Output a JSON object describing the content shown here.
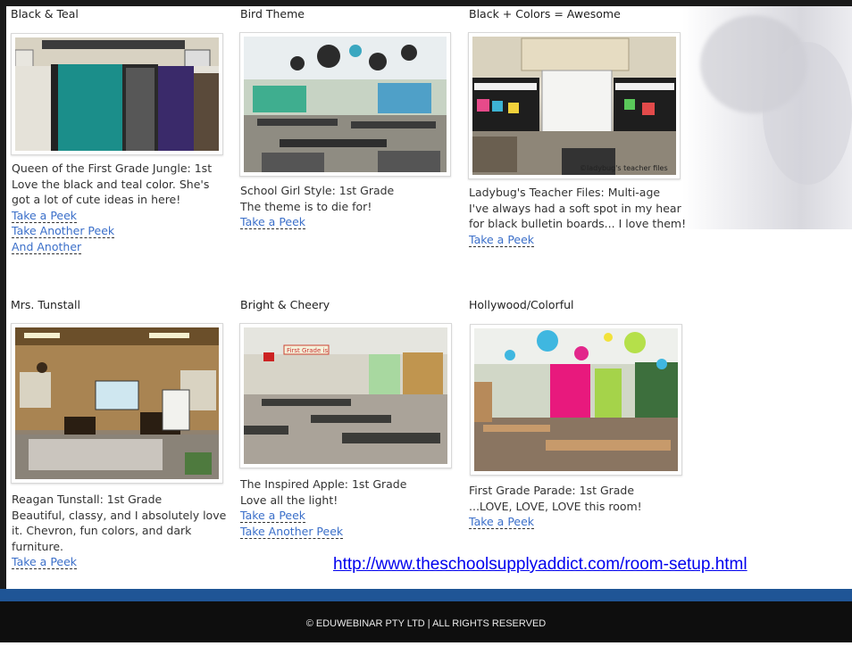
{
  "cards": [
    {
      "title": "Black & Teal",
      "lines": [
        "Queen of the First Grade Jungle: 1st",
        "Love the black and teal color.  She's",
        "got a lot of cute ideas in here!"
      ],
      "links": [
        "Take a Peek",
        "Take Another Peek",
        "And Another"
      ]
    },
    {
      "title": "Bird Theme",
      "lines": [
        "School Girl Style: 1st Grade",
        "The theme is to die for!"
      ],
      "links": [
        "Take a Peek"
      ]
    },
    {
      "title": "Black + Colors = Awesome",
      "lines": [
        "Ladybug's Teacher Files: Multi-age",
        "I've always had a soft spot in my hear",
        "for black bulletin boards... I love them!"
      ],
      "links": [
        "Take a Peek"
      ],
      "photo_caption": "©ladybug's teacher files"
    },
    {
      "title": "Mrs. Tunstall",
      "lines": [
        "Reagan Tunstall: 1st Grade",
        "Beautiful, classy, and I absolutely love",
        "it.  Chevron, fun colors, and dark",
        "furniture."
      ],
      "links": [
        "Take a Peek"
      ]
    },
    {
      "title": "Bright & Cheery",
      "lines": [
        "The Inspired Apple: 1st Grade",
        "Love all the light!"
      ],
      "links": [
        "Take a Peek",
        "Take Another Peek"
      ],
      "photo_caption": "First Grade is"
    },
    {
      "title": "Hollywood/Colorful",
      "lines": [
        "First Grade Parade: 1st Grade",
        "...LOVE, LOVE, LOVE this room!"
      ],
      "links": [
        "Take a Peek"
      ]
    }
  ],
  "source_url": "http://www.theschoolsupplyaddict.com/room-setup.html",
  "footer": "© EDUWEBINAR PTY LTD | ALL RIGHTS RESERVED",
  "colors": {
    "link": "#3b6fc9",
    "url": "#0000ee",
    "blue_bar": "#1f5596",
    "footer_bg": "#0e0e0e"
  }
}
